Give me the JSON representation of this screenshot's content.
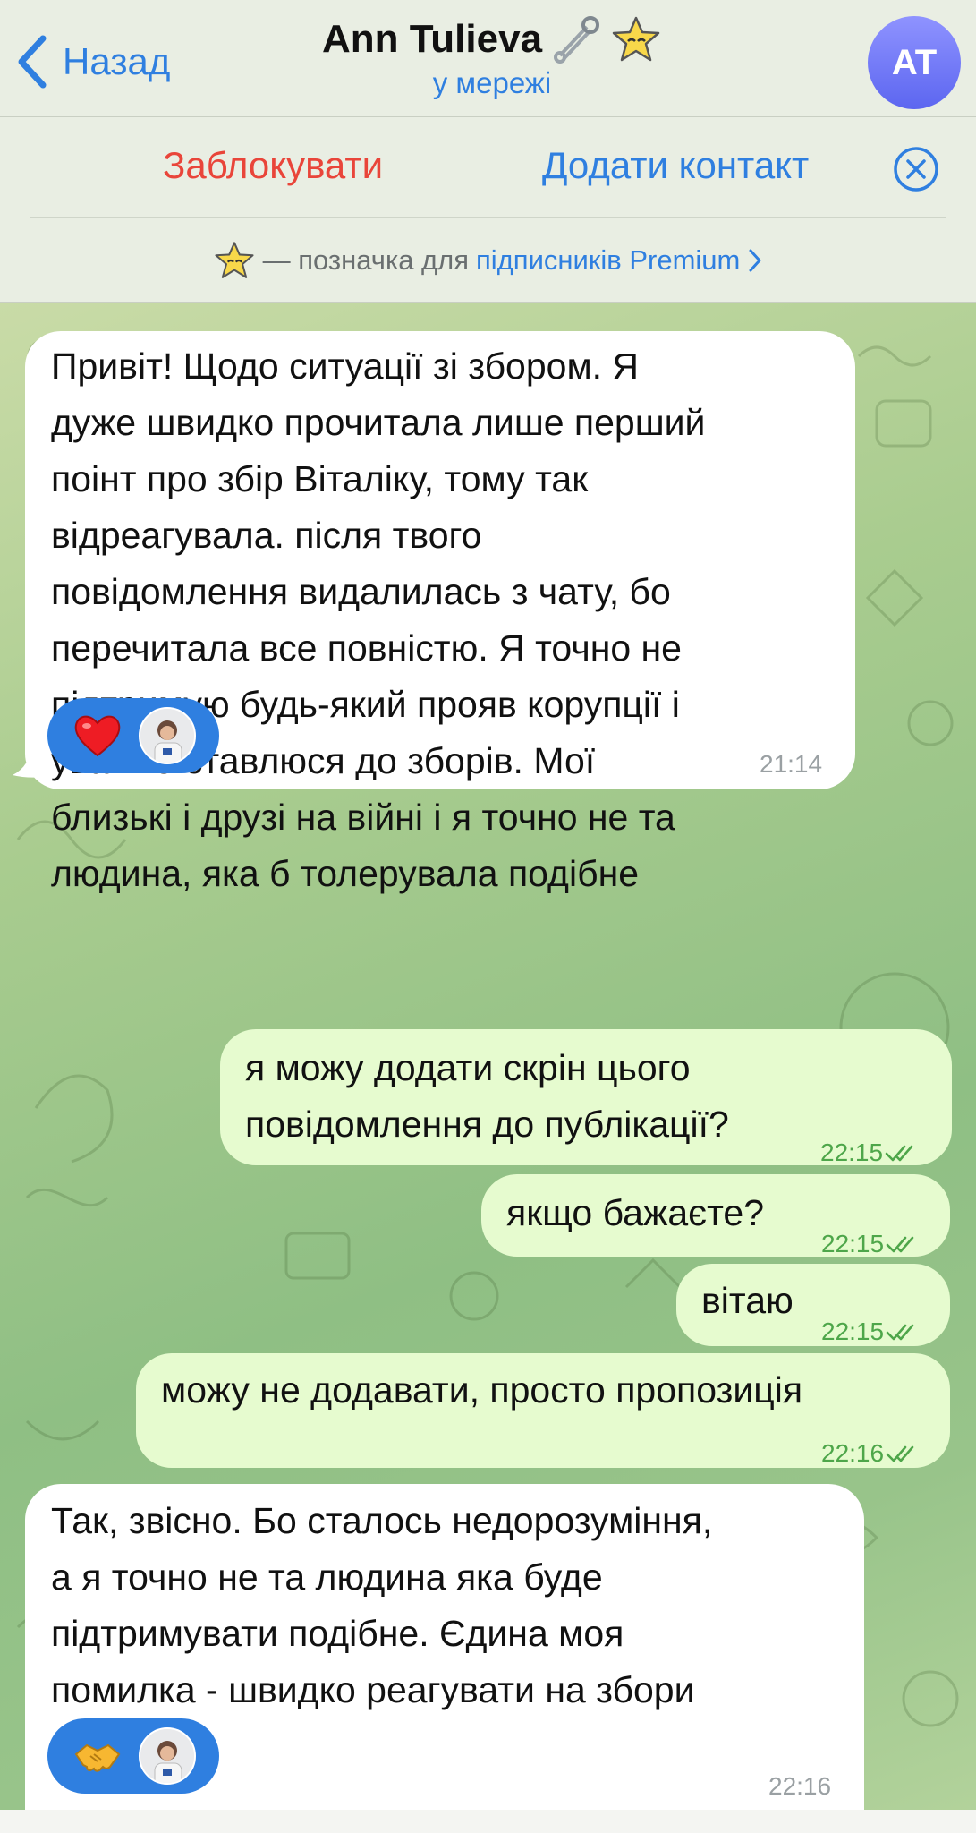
{
  "header": {
    "back_label": "Назад",
    "contact_name": "Ann Tulieva",
    "status": "у мережі",
    "avatar_initials": "AT"
  },
  "actions": {
    "block_label": "Заблокувати",
    "add_contact_label": "Додати контакт"
  },
  "premium_note": {
    "text": "— позначка для",
    "link": "підписників Premium"
  },
  "messages": [
    {
      "direction": "incoming",
      "text": "Привіт! Щодо ситуації зі збором. Я\nдуже швидко прочитала лише перший\nпоінт про збір Віталіку, тому так\nвідреагувала. після твого\nповідомлення видалилась з чату, бо\nперечитала все повністю. Я точно не\nпідтримую будь-який прояв корупції і\nуважно ставлюся до зборів. Мої\nблизькі і друзі на війні і я точно не та\nлюдина, яка б толерувала подібне",
      "time": "21:14",
      "reaction": "heart"
    },
    {
      "direction": "outgoing",
      "text": "я можу додати скрін цього\nповідомлення до публікації?",
      "time": "22:15"
    },
    {
      "direction": "outgoing",
      "text": "якщо бажаєте?",
      "time": "22:15"
    },
    {
      "direction": "outgoing",
      "text": "вітаю",
      "time": "22:15"
    },
    {
      "direction": "outgoing",
      "text": "можу не додавати, просто пропозиція",
      "time": "22:16"
    },
    {
      "direction": "incoming",
      "text": "Так, звісно. Бо сталось недорозуміння,\nа я точно не та людина яка буде\nпідтримувати подібне. Єдина моя\nпомилка - швидко реагувати на збори",
      "time": "22:16",
      "reaction": "handshake"
    }
  ],
  "colors": {
    "accent": "#2f7fe0",
    "danger": "#e9453a",
    "outgoing_bubble": "#e6fbcf",
    "incoming_bubble": "#ffffff",
    "read_check": "#4ea64a"
  },
  "icons": [
    "chevron-left-icon",
    "safety-pin-icon",
    "premium-star-icon",
    "close-circle-icon",
    "double-check-icon",
    "heart-icon",
    "handshake-icon"
  ]
}
